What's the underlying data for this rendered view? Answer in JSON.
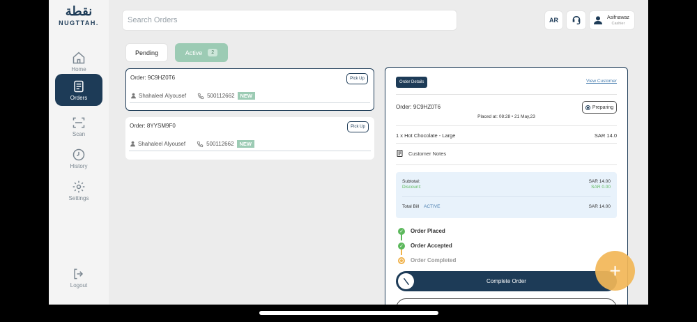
{
  "brand": {
    "arabic": "نقطة",
    "latin": "NUGTTAH."
  },
  "sidebar": {
    "items": [
      {
        "label": "Home",
        "icon": "home-icon"
      },
      {
        "label": "Orders",
        "icon": "orders-icon",
        "active": true
      },
      {
        "label": "Scan",
        "icon": "scan-icon"
      },
      {
        "label": "History",
        "icon": "clock-icon"
      },
      {
        "label": "Settings",
        "icon": "gear-icon"
      }
    ],
    "logout": "Logout"
  },
  "header": {
    "search_placeholder": "Search Orders",
    "lang": "AR",
    "user": {
      "name": "Asifnawaz",
      "role": "Cashier"
    }
  },
  "tabs": {
    "pending": "Pending",
    "active": "Active",
    "active_count": "2"
  },
  "orders": [
    {
      "id": "Order: 9C9HZ0T6",
      "pickup": "Pick Up",
      "customer": "Shahaleel Alyousef",
      "phone": "500112662",
      "badge": "NEW"
    },
    {
      "id": "Order: 8YYSM9F0",
      "pickup": "Pick Up",
      "customer": "Shahaleel Alyousef",
      "phone": "500112662",
      "badge": "NEW"
    }
  ],
  "details": {
    "chip": "Order Details",
    "view_customer": "View Customer",
    "order_id": "Order: 9C9HZ0T6",
    "status": "Preparing",
    "placed_at": "Placed at: 08:28 • 21 May,23",
    "item": {
      "name": "1 x Hot Chocolate - Large",
      "price": "SAR 14.0"
    },
    "notes": "Customer Notes",
    "subtotal_label": "Subtotal:",
    "subtotal": "SAR 14.00",
    "discount_label": "Discount:",
    "discount": "SAR 0.00",
    "total_label": "Total Bill",
    "total_tag": "ACTIVE",
    "total": "SAR 14.00",
    "steps": [
      "Order Placed",
      "Order Accepted",
      "Order Completed"
    ],
    "complete_button": "Complete Order"
  },
  "colors": {
    "primary": "#1d3b57",
    "accent_green": "#9ccbb4",
    "fab": "#f2b757",
    "success": "#5cb85c"
  }
}
